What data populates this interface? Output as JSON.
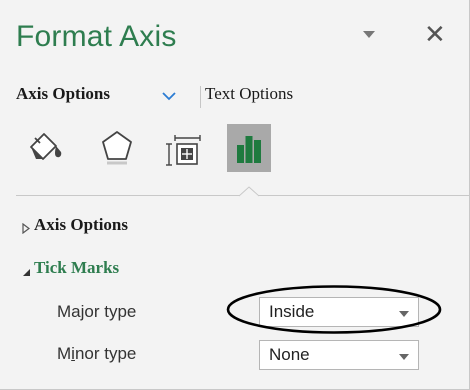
{
  "pane": {
    "title": "Format Axis",
    "title_color": "#2e7d4f"
  },
  "tabs": {
    "axis_options": "Axis Options",
    "text_options": "Text Options"
  },
  "icons": [
    {
      "name": "fill-line-icon",
      "active": false
    },
    {
      "name": "effects-icon",
      "active": false
    },
    {
      "name": "size-properties-icon",
      "active": false
    },
    {
      "name": "axis-options-icon",
      "active": true
    }
  ],
  "sections": {
    "axis_options": {
      "label": "Axis Options",
      "expanded": false
    },
    "tick_marks": {
      "label": "Tick Marks",
      "expanded": true
    }
  },
  "tick_marks": {
    "major_label": "Major type",
    "major_value": "Inside",
    "minor_label_prefix": "M",
    "minor_label_underlined": "i",
    "minor_label_suffix": "nor type",
    "minor_value": "None"
  },
  "colors": {
    "accent_green": "#2e7d4f",
    "chevron_blue": "#2b7cd3",
    "selected_icon_bg": "#a9a9a9"
  }
}
